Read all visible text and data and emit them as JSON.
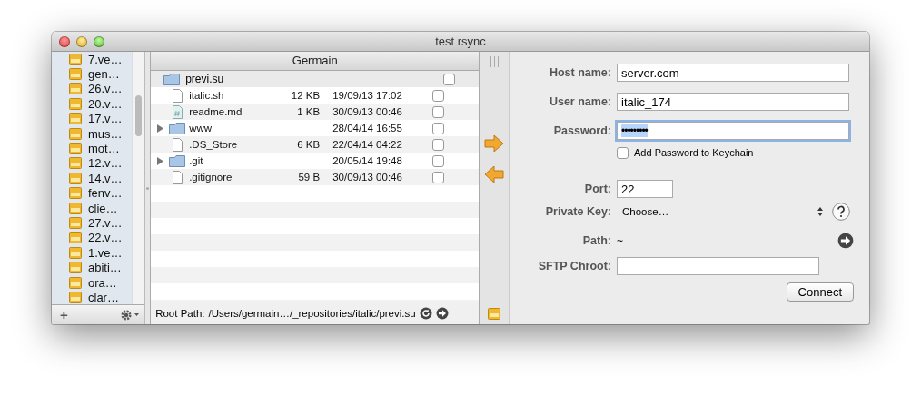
{
  "window": {
    "title": "test rsync"
  },
  "sidebar": {
    "items": [
      {
        "label": "7.ve…"
      },
      {
        "label": "gen…"
      },
      {
        "label": "26.v…"
      },
      {
        "label": "20.v…"
      },
      {
        "label": "17.v…"
      },
      {
        "label": "mus…"
      },
      {
        "label": "mot…"
      },
      {
        "label": "12.v…"
      },
      {
        "label": "14.v…"
      },
      {
        "label": "fenv…"
      },
      {
        "label": "clie…"
      },
      {
        "label": "27.v…"
      },
      {
        "label": "22.v…"
      },
      {
        "label": "1.ve…"
      },
      {
        "label": "abiti…"
      },
      {
        "label": "ora…"
      },
      {
        "label": "clar…"
      }
    ],
    "add_button": "+"
  },
  "file_browser": {
    "title": "Germain",
    "root": {
      "name": "previ.su",
      "checked": false
    },
    "rows": [
      {
        "kind": "file",
        "name": "italic.sh",
        "size": "12 KB",
        "date": "19/09/13 17:02",
        "checked": false
      },
      {
        "kind": "markdown",
        "name": "readme.md",
        "size": "1 KB",
        "date": "30/09/13 00:46",
        "checked": false
      },
      {
        "kind": "folder",
        "name": "www",
        "date": "28/04/14 16:55",
        "expanded": false,
        "checked": false
      },
      {
        "kind": "file",
        "name": ".DS_Store",
        "size": "6 KB",
        "date": "22/04/14 04:22",
        "checked": false
      },
      {
        "kind": "folder",
        "name": ".git",
        "date": "20/05/14 19:48",
        "expanded": false,
        "checked": false
      },
      {
        "kind": "file",
        "name": ".gitignore",
        "size": "59 B",
        "date": "30/09/13 00:46",
        "checked": false
      }
    ],
    "root_path_label": "Root Path:",
    "root_path": "/Users/germain…/_repositories/italic/previ.su"
  },
  "connection": {
    "host_label": "Host name:",
    "host": "server.com",
    "user_label": "User name:",
    "user": "italic_174",
    "password_label": "Password:",
    "password": "•••••••••",
    "keychain": {
      "label": "Add Password to Keychain",
      "checked": false
    },
    "port_label": "Port:",
    "port": "22",
    "key_label": "Private Key:",
    "key": "Choose…",
    "path_label": "Path:",
    "path": "~",
    "chroot_label": "SFTP Chroot:",
    "connect": "Connect"
  }
}
